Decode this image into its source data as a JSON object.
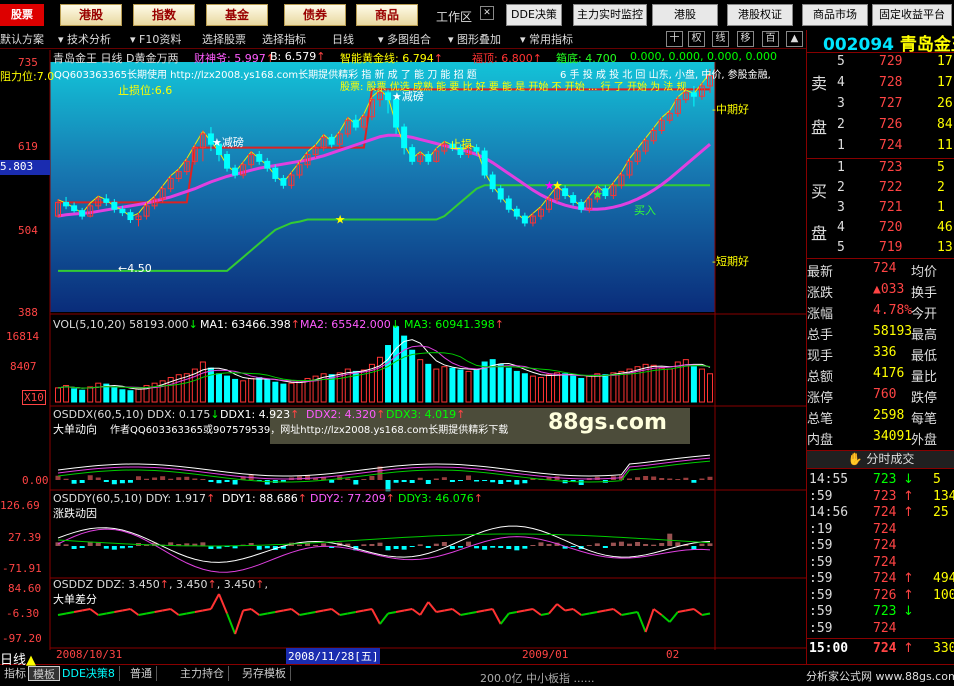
{
  "topbar": {
    "logo": "股票",
    "buttons": [
      "港股",
      "指数",
      "基金",
      "债券",
      "商品"
    ],
    "workspace": "工作区",
    "right_buttons": [
      "DDE决策",
      "主力实时监控",
      "港股",
      "港股权证",
      "商品市场",
      "固定收益平台"
    ]
  },
  "menubar": {
    "items": [
      "默认方案",
      "技术分析",
      "F10资料",
      "选择股票",
      "选择指标",
      "日线",
      "多图组合",
      "图形叠加",
      "常用指标"
    ],
    "icon_buttons": [
      "十",
      "权",
      "线",
      "移",
      "百"
    ]
  },
  "chart": {
    "header": {
      "name": "青岛金王",
      "period": "日线",
      "indicator": "D黄金万两",
      "s1": "财神爷: 5.997",
      "s1_arrow": "↑",
      "s2": "B: 6.579",
      "s2_arrow": "↑",
      "s3": "智能黄金线: 6.794",
      "s3_arrow": "↑",
      "s4": "福顶: 6.800",
      "s4_arrow": "↑",
      "s5": "箱底: 4.700",
      "s6": "0.000, 0.000, 0.000, 0.000"
    },
    "resist": "阻力位:7.0",
    "support": "止损位:6.6",
    "promo1": "QQ603363365长期使用 http://lzx2008.ys168.com长期提供精彩 指 新 成 了 能 刀 能 招 题",
    "promo2": "股票: 股票 优选 成熟 能 要 比 好 要 能 是 开始 不 开始 ... 行 了 开始 为 法 规",
    "promo3": "6 手 投 成 投 北 回 山东, 小盘, 中价, 参股金融,",
    "y_labels": [
      "735",
      "619",
      "504",
      "388"
    ],
    "current": "5.803",
    "ann_jianbang1": "★减磅",
    "ann_jianbang2": "★减磅",
    "ann_zhisun": "止损",
    "ann_low": "←4.50",
    "ann_buy": "买入",
    "mid_good": "中期好",
    "short_good": "短期好",
    "candles": [
      [
        520,
        540,
        518,
        545
      ],
      [
        540,
        535,
        530,
        548
      ],
      [
        535,
        528,
        525,
        540
      ],
      [
        528,
        520,
        515,
        532
      ],
      [
        520,
        535,
        518,
        538
      ],
      [
        535,
        545,
        530,
        550
      ],
      [
        545,
        540,
        535,
        552
      ],
      [
        540,
        530,
        525,
        545
      ],
      [
        530,
        525,
        520,
        535
      ],
      [
        525,
        515,
        510,
        530
      ],
      [
        515,
        520,
        505,
        525
      ],
      [
        520,
        535,
        515,
        540
      ],
      [
        535,
        545,
        530,
        550
      ],
      [
        545,
        560,
        540,
        565
      ],
      [
        560,
        575,
        555,
        580
      ],
      [
        575,
        585,
        570,
        590
      ],
      [
        585,
        600,
        580,
        605
      ],
      [
        600,
        620,
        595,
        625
      ],
      [
        620,
        640,
        600,
        645
      ],
      [
        640,
        625,
        615,
        650
      ],
      [
        625,
        610,
        600,
        630
      ],
      [
        610,
        590,
        585,
        615
      ],
      [
        590,
        580,
        575,
        595
      ],
      [
        580,
        595,
        575,
        600
      ],
      [
        595,
        610,
        590,
        615
      ],
      [
        610,
        600,
        595,
        615
      ],
      [
        600,
        590,
        585,
        605
      ],
      [
        590,
        575,
        570,
        595
      ],
      [
        575,
        565,
        560,
        580
      ],
      [
        565,
        580,
        560,
        585
      ],
      [
        580,
        595,
        575,
        600
      ],
      [
        595,
        610,
        590,
        615
      ],
      [
        610,
        620,
        605,
        625
      ],
      [
        620,
        635,
        615,
        640
      ],
      [
        635,
        625,
        620,
        640
      ],
      [
        625,
        640,
        620,
        645
      ],
      [
        640,
        660,
        635,
        665
      ],
      [
        660,
        650,
        645,
        668
      ],
      [
        650,
        665,
        645,
        670
      ],
      [
        665,
        690,
        660,
        695
      ],
      [
        690,
        700,
        680,
        710
      ],
      [
        700,
        690,
        670,
        705
      ],
      [
        690,
        650,
        640,
        695
      ],
      [
        650,
        620,
        610,
        655
      ],
      [
        620,
        600,
        595,
        625
      ],
      [
        600,
        610,
        595,
        615
      ],
      [
        610,
        600,
        595,
        615
      ],
      [
        600,
        615,
        598,
        620
      ],
      [
        615,
        625,
        610,
        630
      ],
      [
        625,
        620,
        615,
        630
      ],
      [
        620,
        610,
        605,
        625
      ],
      [
        610,
        620,
        605,
        625
      ],
      [
        620,
        615,
        610,
        625
      ],
      [
        615,
        580,
        575,
        620
      ],
      [
        580,
        560,
        555,
        585
      ],
      [
        560,
        545,
        540,
        565
      ],
      [
        545,
        530,
        525,
        550
      ],
      [
        530,
        520,
        515,
        535
      ],
      [
        520,
        510,
        505,
        525
      ],
      [
        510,
        520,
        505,
        525
      ],
      [
        520,
        530,
        515,
        535
      ],
      [
        530,
        545,
        525,
        550
      ],
      [
        545,
        560,
        540,
        565
      ],
      [
        560,
        550,
        545,
        565
      ],
      [
        550,
        540,
        535,
        555
      ],
      [
        540,
        530,
        525,
        545
      ],
      [
        530,
        545,
        525,
        550
      ],
      [
        545,
        560,
        540,
        565
      ],
      [
        560,
        550,
        545,
        565
      ],
      [
        550,
        565,
        545,
        570
      ],
      [
        565,
        580,
        560,
        585
      ],
      [
        580,
        600,
        575,
        605
      ],
      [
        600,
        615,
        595,
        620
      ],
      [
        615,
        630,
        610,
        635
      ],
      [
        630,
        645,
        625,
        650
      ],
      [
        645,
        660,
        640,
        665
      ],
      [
        660,
        670,
        655,
        675
      ],
      [
        670,
        690,
        665,
        695
      ],
      [
        690,
        700,
        685,
        705
      ],
      [
        700,
        695,
        680,
        710
      ],
      [
        695,
        710,
        690,
        715
      ],
      [
        710,
        725,
        700,
        735
      ]
    ],
    "ma": [
      520,
      522,
      523,
      524,
      525,
      527,
      529,
      531,
      533,
      535,
      537,
      539,
      542,
      545,
      548,
      552,
      556,
      560,
      565,
      570,
      574,
      578,
      581,
      584,
      587,
      590,
      592,
      594,
      596,
      598,
      600,
      602,
      605,
      608,
      612,
      616,
      620,
      624,
      628,
      632,
      636,
      638,
      638,
      637,
      635,
      632,
      629,
      626,
      623,
      620,
      617,
      614,
      610,
      605,
      598,
      590,
      582,
      574,
      566,
      558,
      551,
      545,
      540,
      536,
      533,
      531,
      530,
      530,
      531,
      533,
      536,
      540,
      545,
      551,
      558,
      566,
      575,
      585,
      595,
      605,
      615,
      625
    ],
    "stop_line": [
      440,
      440,
      440,
      440,
      440,
      440,
      440,
      440,
      440,
      440,
      440,
      440,
      440,
      440,
      440,
      440,
      440,
      440,
      440,
      440,
      440,
      440,
      450,
      460,
      470,
      480,
      490,
      500,
      505,
      510,
      512,
      515,
      515,
      515,
      515,
      515,
      515,
      515,
      515,
      515,
      515,
      515,
      515,
      515,
      515,
      515,
      515,
      515,
      520,
      530,
      540,
      550,
      560,
      565,
      565,
      565,
      565,
      565,
      565,
      565,
      565,
      565,
      565,
      565,
      565,
      565,
      565,
      565,
      565,
      565,
      565,
      565,
      565,
      565,
      565,
      565,
      565,
      565,
      565,
      565,
      565,
      565
    ],
    "box_top": [
      540,
      540,
      540,
      540,
      540,
      540,
      540,
      540,
      540,
      540,
      540,
      540,
      540,
      540,
      540,
      540,
      540,
      620,
      620,
      620,
      620,
      620,
      620,
      620,
      620,
      620,
      620,
      620,
      620,
      620,
      620,
      620,
      620,
      620,
      620,
      620,
      620,
      620,
      620,
      705,
      705,
      705,
      705,
      705,
      705,
      705,
      705,
      705,
      705,
      705,
      705,
      705,
      705,
      705,
      705,
      705,
      705,
      705,
      705,
      705,
      705,
      705,
      705,
      705,
      705,
      705,
      705,
      705,
      705,
      705,
      705,
      705,
      705,
      705,
      705,
      705,
      705,
      705,
      705,
      705,
      705,
      705
    ]
  },
  "vol": {
    "header": "VOL(5,10,20) 58193.000",
    "h_arrow": "↓",
    "ma1": "MA1: 63466.398",
    "ma1_arrow": "↑",
    "ma2": "MA2: 65542.000",
    "ma2_arrow": "↓",
    "ma3": "MA3: 60941.398",
    "ma3_arrow": "↑",
    "y_labels": [
      "16814",
      "8407",
      "X10"
    ],
    "bars": [
      30,
      35,
      28,
      25,
      32,
      40,
      38,
      30,
      26,
      24,
      28,
      35,
      40,
      45,
      52,
      58,
      60,
      70,
      85,
      72,
      60,
      55,
      48,
      45,
      50,
      52,
      48,
      42,
      38,
      40,
      45,
      50,
      55,
      60,
      58,
      62,
      70,
      65,
      68,
      80,
      95,
      120,
      160,
      140,
      110,
      90,
      80,
      70,
      75,
      72,
      68,
      65,
      70,
      85,
      90,
      80,
      72,
      65,
      60,
      55,
      52,
      58,
      62,
      60,
      55,
      50,
      55,
      60,
      58,
      62,
      65,
      70,
      75,
      80,
      78,
      72,
      70,
      85,
      90,
      75,
      70,
      60
    ],
    "ups": [
      1,
      1,
      0,
      0,
      1,
      1,
      0,
      0,
      0,
      0,
      1,
      1,
      1,
      1,
      1,
      1,
      1,
      1,
      1,
      0,
      0,
      0,
      0,
      1,
      1,
      0,
      0,
      0,
      0,
      1,
      1,
      1,
      1,
      1,
      0,
      1,
      1,
      0,
      1,
      1,
      1,
      0,
      0,
      0,
      0,
      1,
      0,
      1,
      1,
      0,
      0,
      1,
      0,
      0,
      0,
      0,
      0,
      0,
      0,
      1,
      1,
      1,
      1,
      0,
      0,
      0,
      1,
      1,
      0,
      1,
      1,
      1,
      1,
      1,
      1,
      1,
      1,
      1,
      1,
      0,
      1,
      1
    ]
  },
  "ddx": {
    "header": "OSDDX(60,5,10) DDX: 0.175",
    "h_arrow": "↓",
    "ddx1": "DDX1: 4.923",
    "ddx1_arrow": "↑",
    "ddx2": "DDX2: 4.320",
    "ddx2_arrow": "↑",
    "ddx3": "DDX3: 4.019",
    "ddx3_arrow": "↑",
    "title": "大单动向",
    "promo": "作者QQ603363365或907579539，网址http://lzx2008.ys168.com长期提供精彩下载",
    "y_label": "0.00",
    "watermark": "88gs.com"
  },
  "ddy": {
    "header": "OSDDY(60,5,10) DDY: 1.917",
    "h_arrow": "↑",
    "ddy1": "DDY1: 88.686",
    "ddy1_arrow": "↑",
    "ddy2": "DDY2: 77.209",
    "ddy2_arrow": "↑",
    "ddy3": "DDY3: 46.076",
    "ddy3_arrow": "↑",
    "title": "涨跌动因",
    "y_labels": [
      "126.69",
      "27.39",
      "-71.91"
    ]
  },
  "ddz": {
    "header": "OSDDZ DDZ: 3.450",
    "h_arrow": "↑",
    "v2": "3.450",
    "v2_arrow": "↑",
    "v3": "3.450",
    "v3_arrow": "↑",
    "title": "大单差分",
    "y_labels": [
      "84.60",
      "-6.30",
      "-97.20"
    ]
  },
  "dates": {
    "d1": "2008/10/31",
    "d2": "2008/11/28[五]",
    "d3": "2009/01",
    "d4": "02"
  },
  "quote": {
    "code": "002094",
    "name": "青岛金王",
    "sell_label": [
      "卖",
      "盘"
    ],
    "buy_label": [
      "买",
      "盘"
    ],
    "sell": [
      [
        "5",
        "729",
        "17"
      ],
      [
        "4",
        "728",
        "17"
      ],
      [
        "3",
        "727",
        "26"
      ],
      [
        "2",
        "726",
        "84"
      ],
      [
        "1",
        "724",
        "11"
      ]
    ],
    "buy": [
      [
        "1",
        "723",
        "5"
      ],
      [
        "2",
        "722",
        "2"
      ],
      [
        "3",
        "721",
        "1"
      ],
      [
        "4",
        "720",
        "46"
      ],
      [
        "5",
        "719",
        "13"
      ]
    ],
    "stats": [
      [
        "最新",
        "724",
        "均价",
        ""
      ],
      [
        "涨跌",
        "▲033",
        "换手",
        ""
      ],
      [
        "涨幅",
        "4.78%",
        "今开",
        ""
      ],
      [
        "总手",
        "58193",
        "最高",
        ""
      ],
      [
        "现手",
        "336",
        "最低",
        ""
      ],
      [
        "总额",
        "4176",
        "量比",
        ""
      ],
      [
        "涨停",
        "760",
        "跌停",
        ""
      ],
      [
        "总笔",
        "2598",
        "每笔",
        ""
      ],
      [
        "内盘",
        "34091",
        "外盘",
        ""
      ]
    ],
    "ticks_title": "分时成交",
    "ticks": [
      [
        "14:55",
        "723",
        "↓",
        "5"
      ],
      [
        ":59",
        "723",
        "↑",
        "134"
      ],
      [
        "14:56",
        "724",
        "↑",
        "25"
      ],
      [
        ":19",
        "724",
        "",
        ""
      ],
      [
        ":59",
        "724",
        "",
        ""
      ],
      [
        ":59",
        "724",
        "",
        ""
      ],
      [
        ":59",
        "724",
        "↑",
        "494"
      ],
      [
        ":59",
        "726",
        "↑",
        "100"
      ],
      [
        ":59",
        "723",
        "↓",
        ""
      ],
      [
        ":59",
        "724",
        "",
        ""
      ]
    ],
    "close_row": [
      "15:00",
      "724",
      "↑",
      "330"
    ],
    "footer": "分析家公式网 www.88gs.com"
  },
  "bottom": {
    "left": "日线",
    "tabs": [
      "指标",
      "模板",
      "DDE决策8",
      "普通",
      "主力持仓",
      "另存模板"
    ],
    "status": "200.0亿 中小板指 ......"
  }
}
